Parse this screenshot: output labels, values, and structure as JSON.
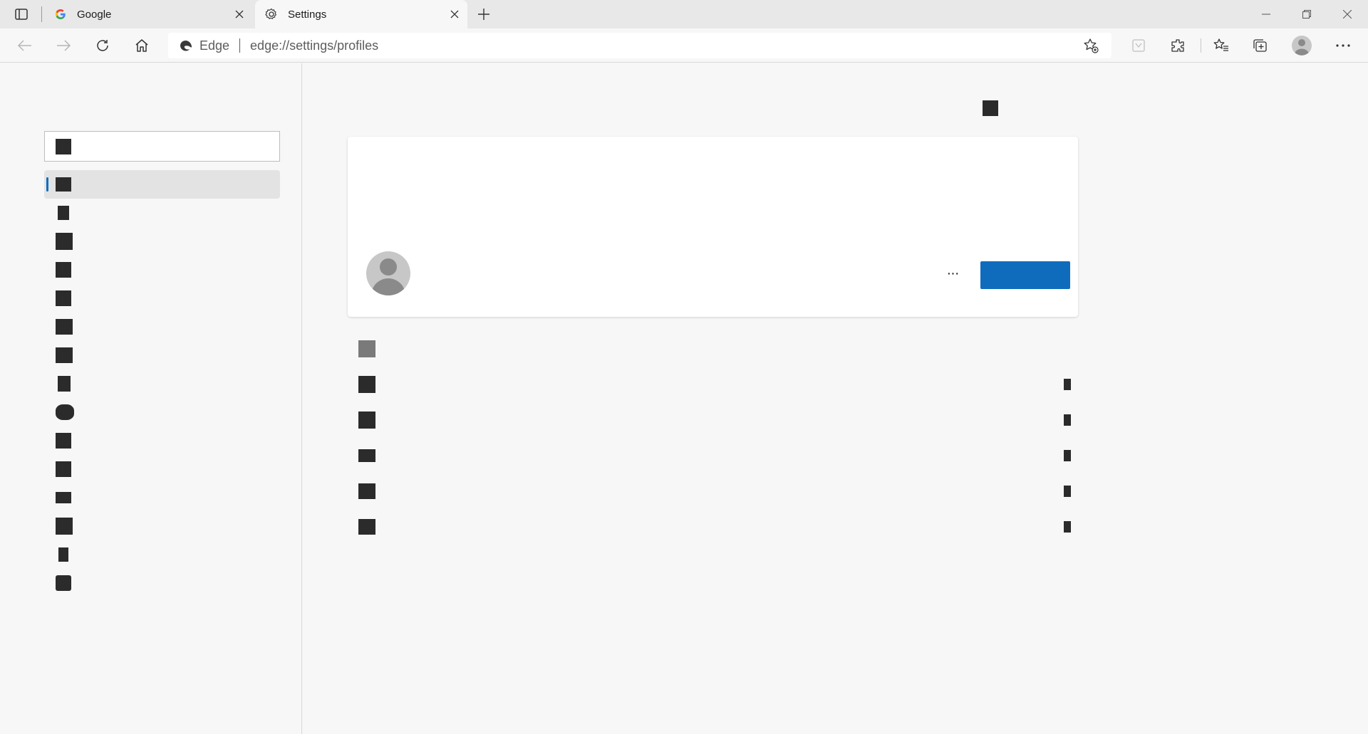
{
  "browser": {
    "tabs": [
      {
        "title": "Google",
        "active": false,
        "icon": "google-g-icon"
      },
      {
        "title": "Settings",
        "active": true,
        "icon": "gear-icon"
      }
    ],
    "address_bar": {
      "site_label": "Edge",
      "url": "edge://settings/profiles"
    },
    "accent_color": "#0f6cbd"
  },
  "settings": {
    "search": {
      "placeholder": ""
    },
    "nav_items": [
      {
        "label": "",
        "selected": true
      },
      {
        "label": ""
      },
      {
        "label": ""
      },
      {
        "label": ""
      },
      {
        "label": ""
      },
      {
        "label": ""
      },
      {
        "label": ""
      },
      {
        "label": ""
      },
      {
        "label": ""
      },
      {
        "label": ""
      },
      {
        "label": ""
      },
      {
        "label": ""
      },
      {
        "label": ""
      },
      {
        "label": ""
      },
      {
        "label": ""
      }
    ],
    "profile_card": {
      "more_label": "···",
      "primary_button_label": ""
    },
    "rows": [
      {
        "label": ""
      },
      {
        "label": ""
      },
      {
        "label": ""
      },
      {
        "label": ""
      },
      {
        "label": ""
      },
      {
        "label": ""
      }
    ]
  }
}
